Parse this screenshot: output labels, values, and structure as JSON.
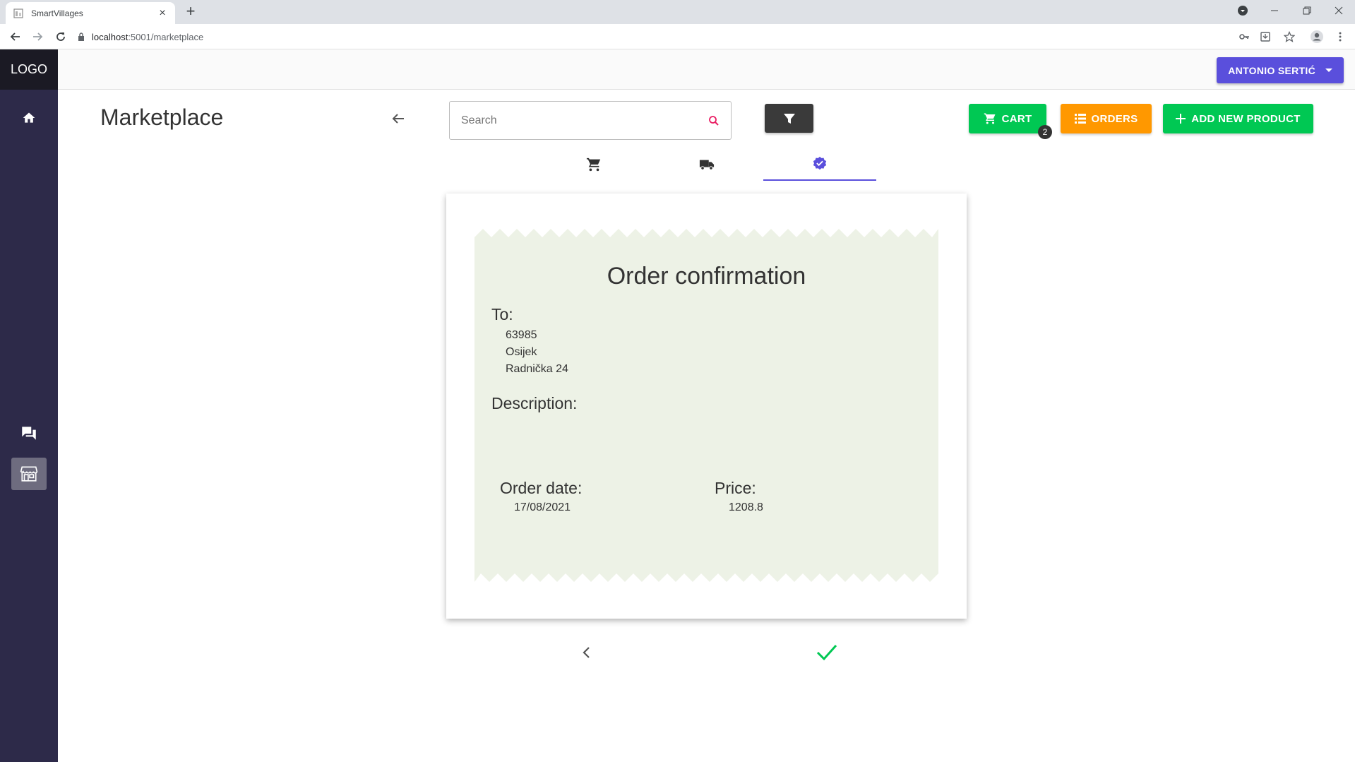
{
  "browser": {
    "tab_title": "SmartVillages",
    "url_host": "localhost",
    "url_path": ":5001/marketplace"
  },
  "sidebar": {
    "logo": "LOGO",
    "items": [
      {
        "icon": "home-icon"
      },
      {
        "icon": "forum-icon"
      },
      {
        "icon": "store-icon",
        "active": true
      }
    ]
  },
  "topbar": {
    "user_name": "ANTONIO SERTIĆ"
  },
  "header": {
    "title": "Marketplace",
    "search_placeholder": "Search",
    "cart_label": "CART",
    "cart_count": "2",
    "orders_label": "ORDERS",
    "add_label": "ADD NEW PRODUCT"
  },
  "steps": [
    {
      "icon": "cart-icon"
    },
    {
      "icon": "truck-icon"
    },
    {
      "icon": "verified-icon",
      "active": true
    }
  ],
  "receipt": {
    "title": "Order confirmation",
    "to_label": "To:",
    "address_postcode": "63985",
    "address_city": "Osijek",
    "address_street": "Radnička 24",
    "description_label": "Description:",
    "description_value": "",
    "order_date_label": "Order date:",
    "order_date_value": "17/08/2021",
    "price_label": "Price:",
    "price_value": "1208.8"
  },
  "colors": {
    "sidebar": "#2d2a49",
    "primary": "#5a4fdc",
    "green": "#00c853",
    "orange": "#ff9800",
    "receipt_bg": "#edf2e6"
  }
}
